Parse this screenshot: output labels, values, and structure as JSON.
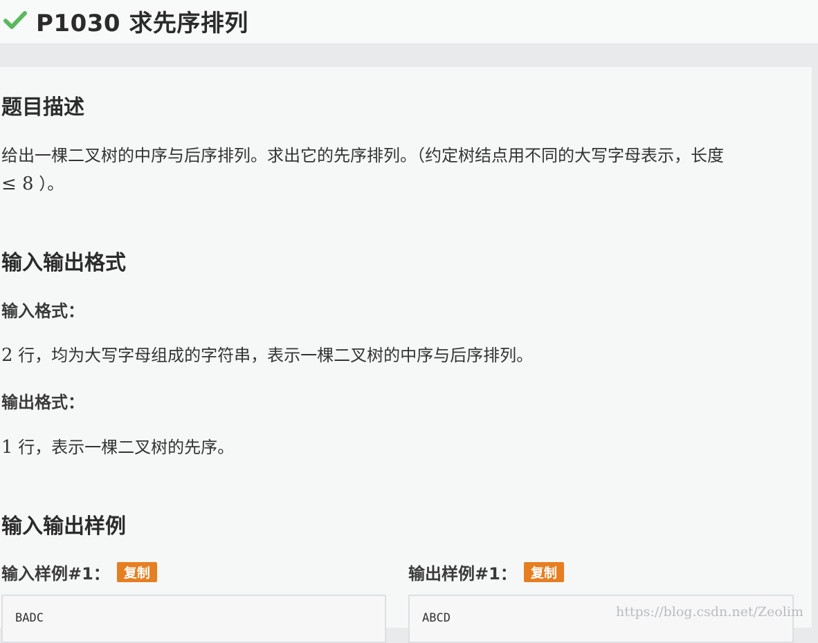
{
  "header": {
    "title": "P1030 求先序排列",
    "status_icon": "check-icon",
    "status_color": "#5cb85c"
  },
  "description": {
    "heading": "题目描述",
    "line1": "给出一棵二叉树的中序与后序排列。求出它的先序排列。（约定树结点用不同的大写字母表示，长度",
    "line2_math": "≤ 8",
    "line2_suffix": "）。"
  },
  "io_format": {
    "heading": "输入输出格式",
    "input_label": "输入格式：",
    "input_math": "2",
    "input_text": "行，均为大写字母组成的字符串，表示一棵二叉树的中序与后序排列。",
    "output_label": "输出格式：",
    "output_math": "1",
    "output_text": "行，表示一棵二叉树的先序。"
  },
  "samples": {
    "heading": "输入输出样例",
    "input_label": "输入样例#1：",
    "output_label": "输出样例#1：",
    "copy_label": "复制",
    "input_value": "BADC",
    "output_value": "ABCD",
    "badge_color": "#e67e22"
  },
  "watermark": "https://blog.csdn.net/Zeolim"
}
